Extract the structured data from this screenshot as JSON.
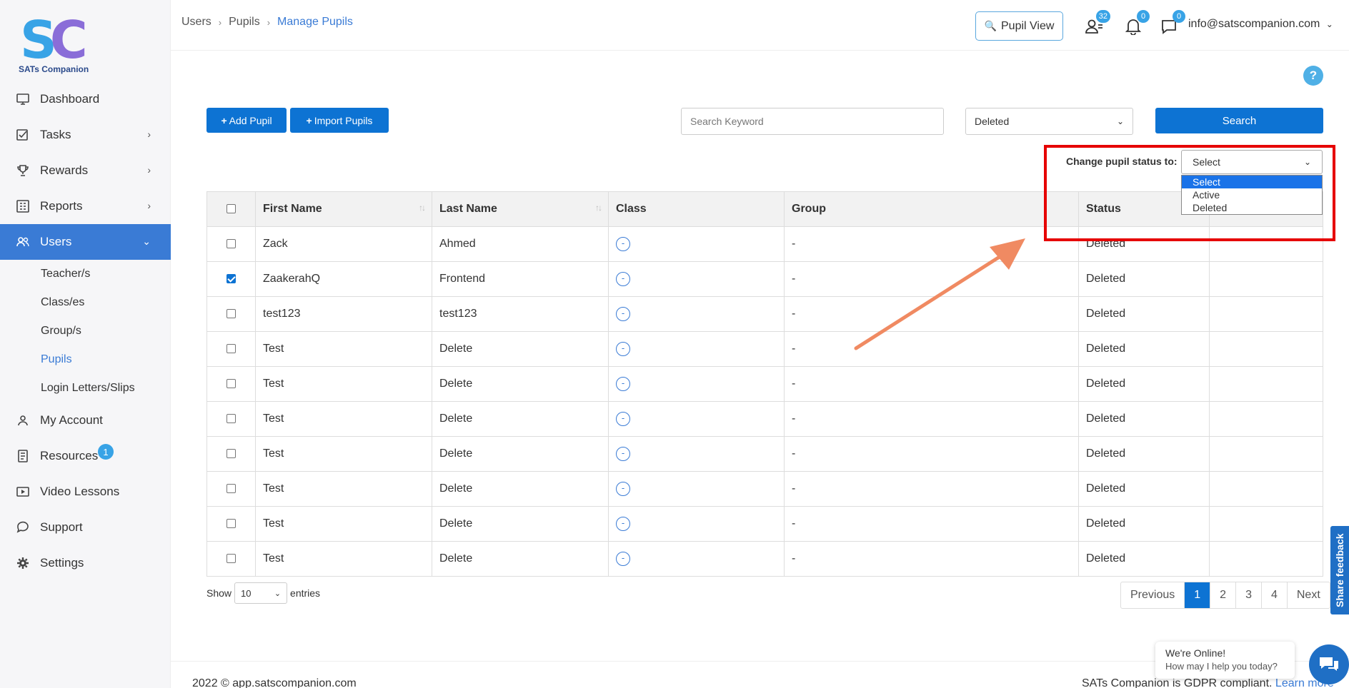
{
  "brand": {
    "name": "SATs Companion",
    "mark_s": "S",
    "mark_c": "C"
  },
  "sidebar": {
    "items": [
      {
        "label": "Dashboard",
        "icon": "monitor-icon"
      },
      {
        "label": "Tasks",
        "icon": "tasks-icon"
      },
      {
        "label": "Rewards",
        "icon": "trophy-icon"
      },
      {
        "label": "Reports",
        "icon": "reports-icon"
      },
      {
        "label": "Users",
        "icon": "users-icon"
      },
      {
        "label": "My Account",
        "icon": "account-icon"
      },
      {
        "label": "Resources",
        "icon": "resources-icon",
        "badge": "1"
      },
      {
        "label": "Video Lessons",
        "icon": "video-icon"
      },
      {
        "label": "Support",
        "icon": "support-icon"
      },
      {
        "label": "Settings",
        "icon": "gear-icon"
      }
    ],
    "users_sub": [
      {
        "label": "Teacher/s"
      },
      {
        "label": "Class/es"
      },
      {
        "label": "Group/s"
      },
      {
        "label": "Pupils"
      },
      {
        "label": "Login Letters/Slips"
      }
    ]
  },
  "breadcrumb": {
    "items": [
      "Users",
      "Pupils",
      "Manage Pupils"
    ]
  },
  "topbar": {
    "pupil_view": "Pupil View",
    "users_count": "32",
    "notifications_count": "0",
    "messages_count": "0",
    "email": "info@satscompanion.com"
  },
  "toolbar": {
    "add_pupil": "Add Pupil",
    "import_pupils": "Import Pupils",
    "search_placeholder": "Search Keyword",
    "status_value": "Deleted",
    "search_button": "Search"
  },
  "change_status": {
    "label": "Change pupil status to:",
    "value": "Select",
    "options": [
      "Select",
      "Active",
      "Deleted"
    ]
  },
  "table": {
    "headers": [
      "First Name",
      "Last Name",
      "Class",
      "Group",
      "Status"
    ],
    "rows": [
      {
        "first": "Zack",
        "last": "Ahmed",
        "class": "-",
        "group": "-",
        "status": "Deleted",
        "checked": false
      },
      {
        "first": "ZaakerahQ",
        "last": "Frontend",
        "class": "-",
        "group": "-",
        "status": "Deleted",
        "checked": true
      },
      {
        "first": "test123",
        "last": "test123",
        "class": "-",
        "group": "-",
        "status": "Deleted",
        "checked": false
      },
      {
        "first": "Test",
        "last": "Delete",
        "class": "-",
        "group": "-",
        "status": "Deleted",
        "checked": false
      },
      {
        "first": "Test",
        "last": "Delete",
        "class": "-",
        "group": "-",
        "status": "Deleted",
        "checked": false
      },
      {
        "first": "Test",
        "last": "Delete",
        "class": "-",
        "group": "-",
        "status": "Deleted",
        "checked": false
      },
      {
        "first": "Test",
        "last": "Delete",
        "class": "-",
        "group": "-",
        "status": "Deleted",
        "checked": false
      },
      {
        "first": "Test",
        "last": "Delete",
        "class": "-",
        "group": "-",
        "status": "Deleted",
        "checked": false
      },
      {
        "first": "Test",
        "last": "Delete",
        "class": "-",
        "group": "-",
        "status": "Deleted",
        "checked": false
      },
      {
        "first": "Test",
        "last": "Delete",
        "class": "-",
        "group": "-",
        "status": "Deleted",
        "checked": false
      }
    ]
  },
  "entries": {
    "show": "Show",
    "value": "10",
    "suffix": "entries"
  },
  "pagination": {
    "previous": "Previous",
    "pages": [
      "1",
      "2",
      "3",
      "4"
    ],
    "next": "Next",
    "current": "1"
  },
  "footer": {
    "copyright": "2022 © app.satscompanion.com",
    "compliance": "SATs Companion is GDPR compliant.",
    "learn_more": "Learn more"
  },
  "feedback": "Share feedback",
  "chat": {
    "title": "We're Online!",
    "subtitle": "How may I help you today?"
  },
  "help": "?",
  "colors": {
    "primary": "#0d73d3",
    "sidebar_active": "#3a7bd5",
    "highlight": "#e60000",
    "annotation_arrow": "#f08a62"
  }
}
